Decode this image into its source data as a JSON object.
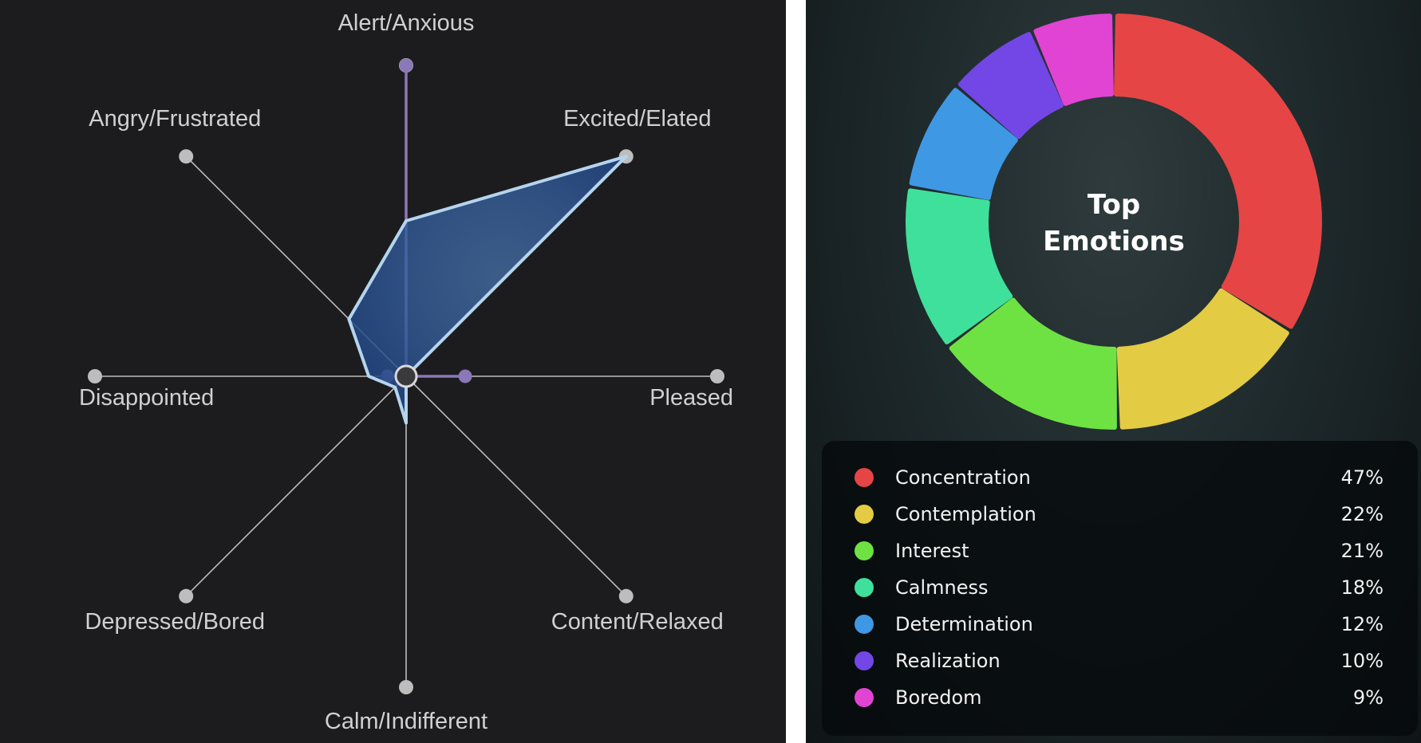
{
  "chart_data": [
    {
      "type": "radar",
      "axes": [
        "Alert/Anxious",
        "Excited/Elated",
        "Pleased",
        "Content/Relaxed",
        "Calm/Indifferent",
        "Depressed/Bored",
        "Disappointed",
        "Angry/Frustrated"
      ],
      "max": 1,
      "series": [
        {
          "color": "#8a78b8",
          "values": [
            1.0,
            0.0,
            0.19,
            0.0,
            0.0,
            0.0,
            0.06,
            0.0
          ]
        },
        {
          "color": "#b5d4ee",
          "values": [
            0.5,
            1.0,
            0.0,
            0.0,
            0.15,
            0.05,
            0.12,
            0.26
          ]
        }
      ],
      "colors": {
        "axis": "#bdbdbd",
        "endpoint": "#bdbdbd",
        "center": "#3a3a3c"
      }
    },
    {
      "type": "pie",
      "variant": "donut",
      "title_lines": [
        "Top",
        "Emotions"
      ],
      "categories": [
        "Concentration",
        "Contemplation",
        "Interest",
        "Calmness",
        "Determination",
        "Realization",
        "Boredom"
      ],
      "values": [
        47,
        22,
        21,
        18,
        12,
        10,
        9
      ],
      "value_labels": [
        "47%",
        "22%",
        "21%",
        "18%",
        "12%",
        "10%",
        "9%"
      ],
      "colors": [
        "#e64545",
        "#e3cb44",
        "#6ee243",
        "#3fe09b",
        "#3e98e4",
        "#7347e6",
        "#e144d3"
      ]
    }
  ]
}
